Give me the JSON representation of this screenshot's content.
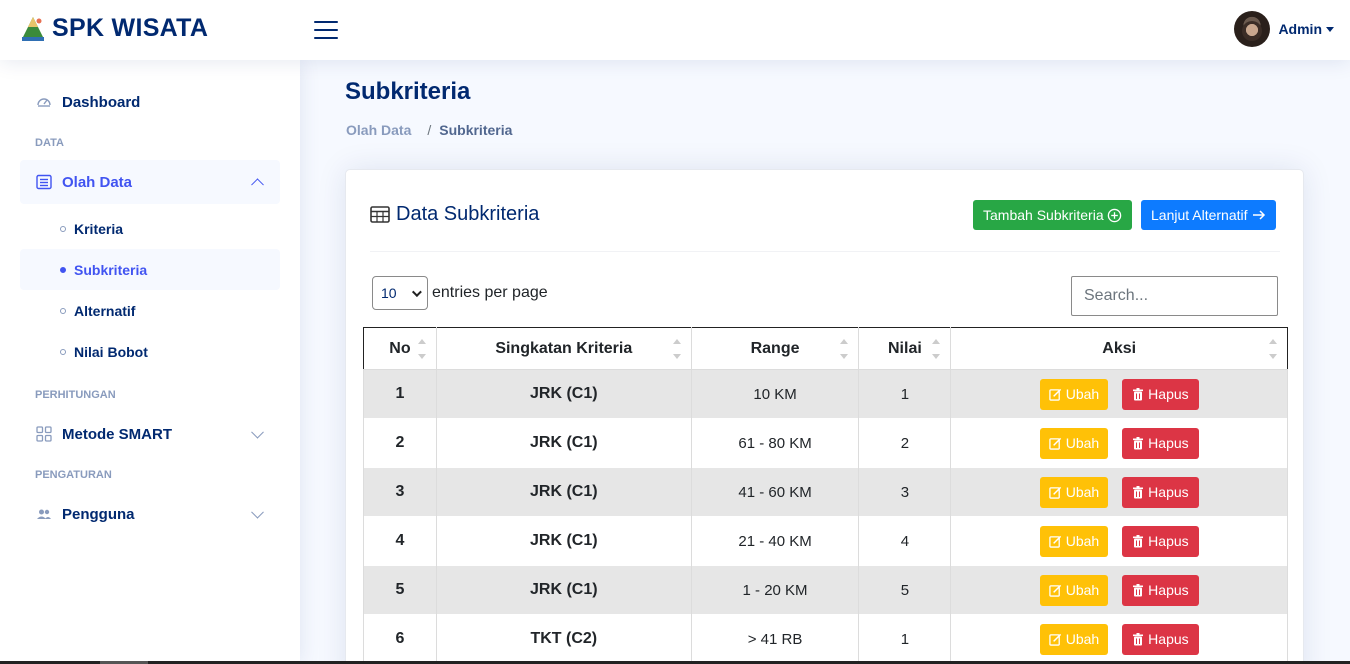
{
  "brand": {
    "title": "SPK WISATA"
  },
  "user": {
    "name": "Admin"
  },
  "sidebar": {
    "dashboard": "Dashboard",
    "heading_data": "DATA",
    "olah_data": "Olah Data",
    "sub_items": [
      "Kriteria",
      "Subkriteria",
      "Alternatif",
      "Nilai Bobot"
    ],
    "heading_perhitungan": "PERHITUNGAN",
    "metode": "Metode SMART",
    "heading_pengaturan": "PENGATURAN",
    "pengguna": "Pengguna"
  },
  "page": {
    "title": "Subkriteria",
    "breadcrumb": [
      "Olah Data",
      "Subkriteria"
    ]
  },
  "card": {
    "title": "Data Subkriteria",
    "add_button": "Tambah Subkriteria",
    "next_button": "Lanjut Alternatif",
    "entries_value": "10",
    "entries_label": "entries per page",
    "search_placeholder": "Search..."
  },
  "table": {
    "headers": [
      "No",
      "Singkatan Kriteria",
      "Range",
      "Nilai",
      "Aksi"
    ],
    "rows": [
      {
        "no": "1",
        "kriteria": "JRK (C1)",
        "range": "10 KM",
        "nilai": "1"
      },
      {
        "no": "2",
        "kriteria": "JRK (C1)",
        "range": "61 - 80 KM",
        "nilai": "2"
      },
      {
        "no": "3",
        "kriteria": "JRK (C1)",
        "range": "41 - 60 KM",
        "nilai": "3"
      },
      {
        "no": "4",
        "kriteria": "JRK (C1)",
        "range": "21 - 40 KM",
        "nilai": "4"
      },
      {
        "no": "5",
        "kriteria": "JRK (C1)",
        "range": "1 - 20 KM",
        "nilai": "5"
      },
      {
        "no": "6",
        "kriteria": "TKT (C2)",
        "range": "> 41 RB",
        "nilai": "1"
      }
    ],
    "edit_label": "Ubah",
    "delete_label": "Hapus"
  },
  "colors": {
    "primary": "#012970",
    "accent": "#4154f1",
    "success": "#28a745",
    "info": "#0d7bff",
    "warning": "#ffc107",
    "danger": "#dc3545"
  }
}
